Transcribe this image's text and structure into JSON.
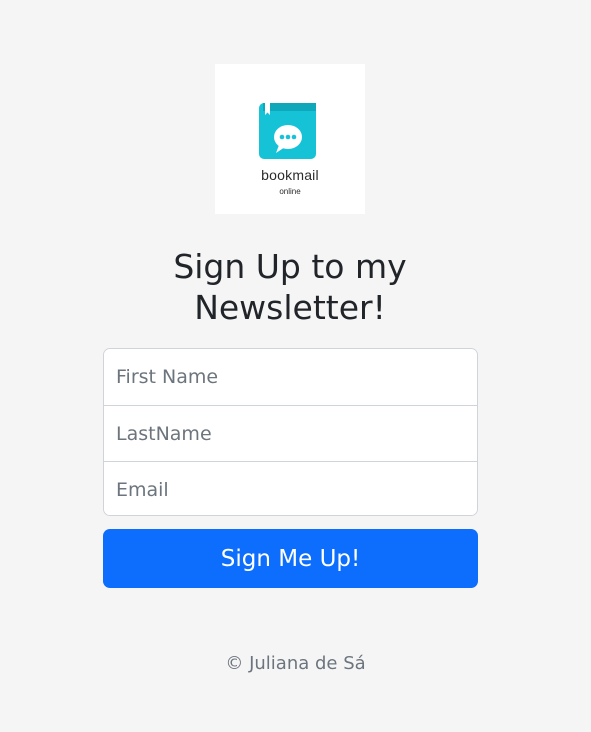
{
  "logo": {
    "wordmark": "bookmail",
    "subtitle": "online",
    "icon": "book-chat-icon",
    "accent_color": "#16c3d6"
  },
  "heading": "Sign Up to my Newsletter!",
  "form": {
    "first_name_placeholder": "First Name",
    "last_name_placeholder": "LastName",
    "email_placeholder": "Email",
    "submit_label": "Sign Me Up!",
    "button_color": "#0d6efd"
  },
  "footer": {
    "copyright": "© Juliana de Sá"
  }
}
